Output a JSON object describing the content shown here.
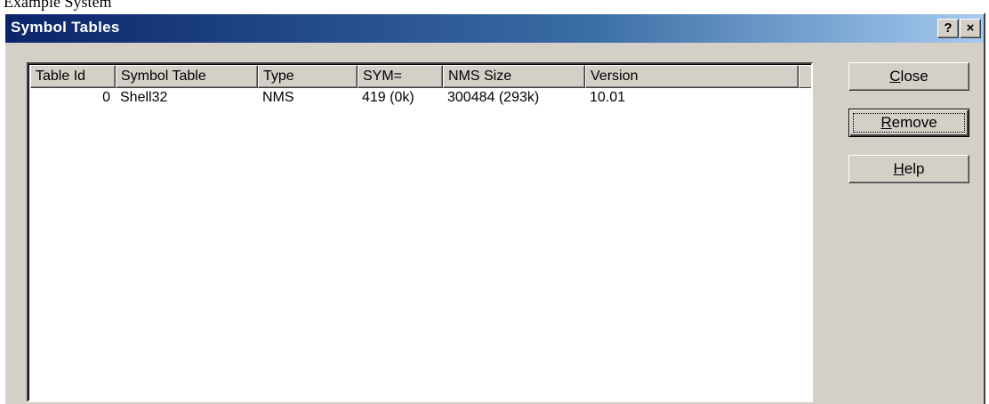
{
  "page": {
    "top_text": "Example System"
  },
  "window": {
    "title": "Symbol Tables",
    "help_glyph": "?",
    "close_glyph": "×"
  },
  "table": {
    "columns": [
      "Table Id",
      "Symbol Table",
      "Type",
      "SYM=",
      "NMS Size",
      "Version"
    ],
    "rows": [
      {
        "table_id": "0",
        "symbol_table": "Shell32",
        "type": "NMS",
        "sym": "419 (0k)",
        "nms_size": "300484 (293k)",
        "version": "10.01"
      }
    ]
  },
  "buttons": {
    "close": {
      "accel": "C",
      "rest": "lose"
    },
    "remove": {
      "accel": "R",
      "rest": "emove"
    },
    "help": {
      "accel": "H",
      "rest": "elp"
    }
  },
  "colors": {
    "face": "#d4d0c8",
    "title_start": "#0a246a",
    "title_end": "#a6caf0"
  }
}
